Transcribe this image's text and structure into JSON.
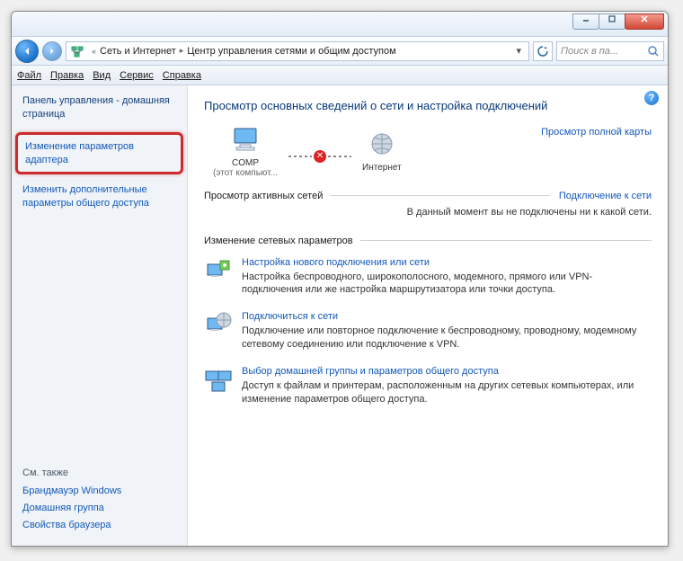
{
  "titlebar": {},
  "navbar": {
    "breadcrumb": {
      "item1": "Сеть и Интернет",
      "item2": "Центр управления сетями и общим доступом"
    },
    "search_placeholder": "Поиск в па..."
  },
  "menubar": {
    "file": "Файл",
    "edit": "Правка",
    "view": "Вид",
    "service": "Сервис",
    "help": "Справка"
  },
  "sidebar": {
    "cp_home": "Панель управления - домашняя страница",
    "adapter_settings": "Изменение параметров адаптера",
    "sharing_settings": "Изменить дополнительные параметры общего доступа",
    "see_also_label": "См. также",
    "firewall": "Брандмауэр Windows",
    "homegroup": "Домашняя группа",
    "browser_props": "Свойства браузера"
  },
  "main": {
    "heading": "Просмотр основных сведений о сети и настройка подключений",
    "view_full_map": "Просмотр полной карты",
    "node_comp": "COMP",
    "node_comp_sub": "(этот компьют...",
    "node_internet": "Интернет",
    "active_nets_title": "Просмотр активных сетей",
    "connect_link": "Подключение к сети",
    "no_networks": "В данный момент вы не подключены ни к какой сети.",
    "change_settings_title": "Изменение сетевых параметров",
    "tasks": [
      {
        "title": "Настройка нового подключения или сети",
        "desc": "Настройка беспроводного, широкополосного, модемного, прямого или VPN-подключения или же настройка маршрутизатора или точки доступа."
      },
      {
        "title": "Подключиться к сети",
        "desc": "Подключение или повторное подключение к беспроводному, проводному, модемному сетевому соединению или подключение к VPN."
      },
      {
        "title": "Выбор домашней группы и параметров общего доступа",
        "desc": "Доступ к файлам и принтерам, расположенным на других сетевых компьютерах, или изменение параметров общего доступа."
      }
    ]
  }
}
